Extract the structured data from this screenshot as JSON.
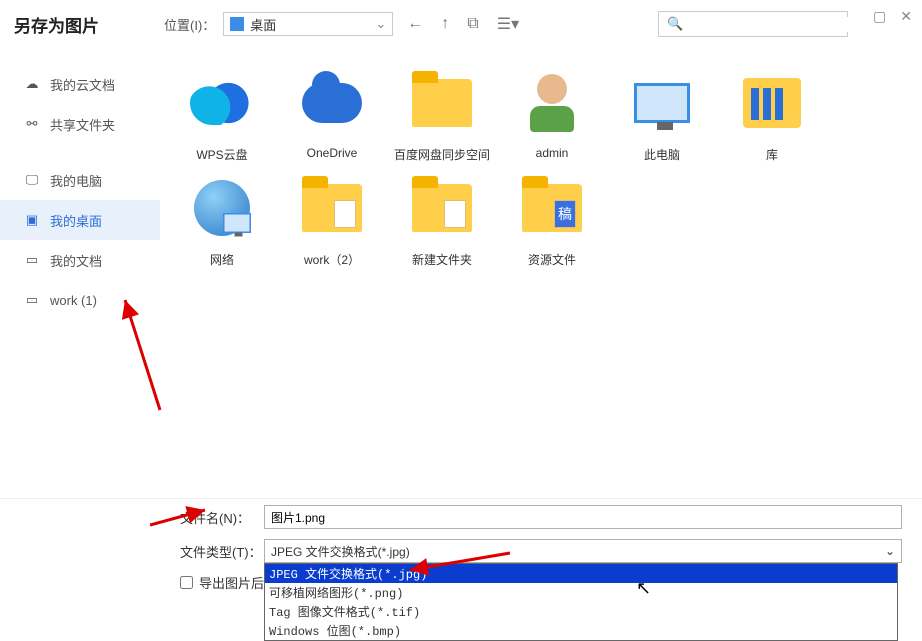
{
  "window": {
    "title": "另存为图片"
  },
  "location": {
    "label": "位置(I)：",
    "value": "桌面"
  },
  "search": {
    "placeholder": ""
  },
  "sidebar": {
    "items": [
      {
        "label": "我的云文档",
        "icon": "☁"
      },
      {
        "label": "共享文件夹",
        "icon": "⚯"
      },
      {
        "label": "我的电脑",
        "icon": "🖵"
      },
      {
        "label": "我的桌面",
        "icon": "▣"
      },
      {
        "label": "我的文档",
        "icon": "▭"
      },
      {
        "label": "work (1)",
        "icon": "▭"
      }
    ],
    "active_index": 3
  },
  "grid": {
    "items": [
      {
        "label": "WPS云盘",
        "type": "cloud-blue"
      },
      {
        "label": "OneDrive",
        "type": "onedrive"
      },
      {
        "label": "百度网盘同步空间",
        "type": "folder"
      },
      {
        "label": "admin",
        "type": "user"
      },
      {
        "label": "此电脑",
        "type": "monitor"
      },
      {
        "label": "库",
        "type": "lib"
      },
      {
        "label": "网络",
        "type": "globe"
      },
      {
        "label": "work（2）",
        "type": "folder-paper"
      },
      {
        "label": "新建文件夹",
        "type": "folder-paper"
      },
      {
        "label": "资源文件",
        "type": "folder-paper-blue"
      }
    ]
  },
  "form": {
    "filename_label": "文件名(N)：",
    "filename_value": "图片1.png",
    "filetype_label": "文件类型(T)：",
    "filetype_value": "JPEG 文件交换格式(*.jpg)",
    "export_label": "导出图片后",
    "dropdown_options": [
      "JPEG 文件交换格式(*.jpg)",
      "可移植网络图形(*.png)",
      "Tag 图像文件格式(*.tif)",
      "Windows 位图(*.bmp)"
    ],
    "dropdown_selected_index": 0
  }
}
